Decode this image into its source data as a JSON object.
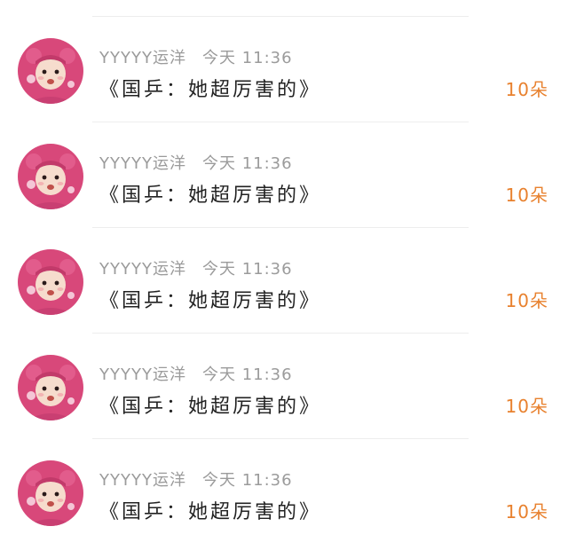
{
  "colors": {
    "accent": "#e8812e",
    "username": "#9b9b9b",
    "content": "#222222",
    "divider": "#ededed",
    "avatar_pink": "#d8487a"
  },
  "items": [
    {
      "avatar_icon": "avatar-pink-hood-baby",
      "username": "YYYYY运洋",
      "time": "今天 11:36",
      "content": "《国乒：她超厉害的》",
      "count": "10朵"
    },
    {
      "avatar_icon": "avatar-pink-hood-baby",
      "username": "YYYYY运洋",
      "time": "今天 11:36",
      "content": "《国乒：她超厉害的》",
      "count": "10朵"
    },
    {
      "avatar_icon": "avatar-pink-hood-baby",
      "username": "YYYYY运洋",
      "time": "今天 11:36",
      "content": "《国乒：她超厉害的》",
      "count": "10朵"
    },
    {
      "avatar_icon": "avatar-pink-hood-baby",
      "username": "YYYYY运洋",
      "time": "今天 11:36",
      "content": "《国乒：她超厉害的》",
      "count": "10朵"
    },
    {
      "avatar_icon": "avatar-pink-hood-baby",
      "username": "YYYYY运洋",
      "time": "今天 11:36",
      "content": "《国乒：她超厉害的》",
      "count": "10朵"
    }
  ]
}
